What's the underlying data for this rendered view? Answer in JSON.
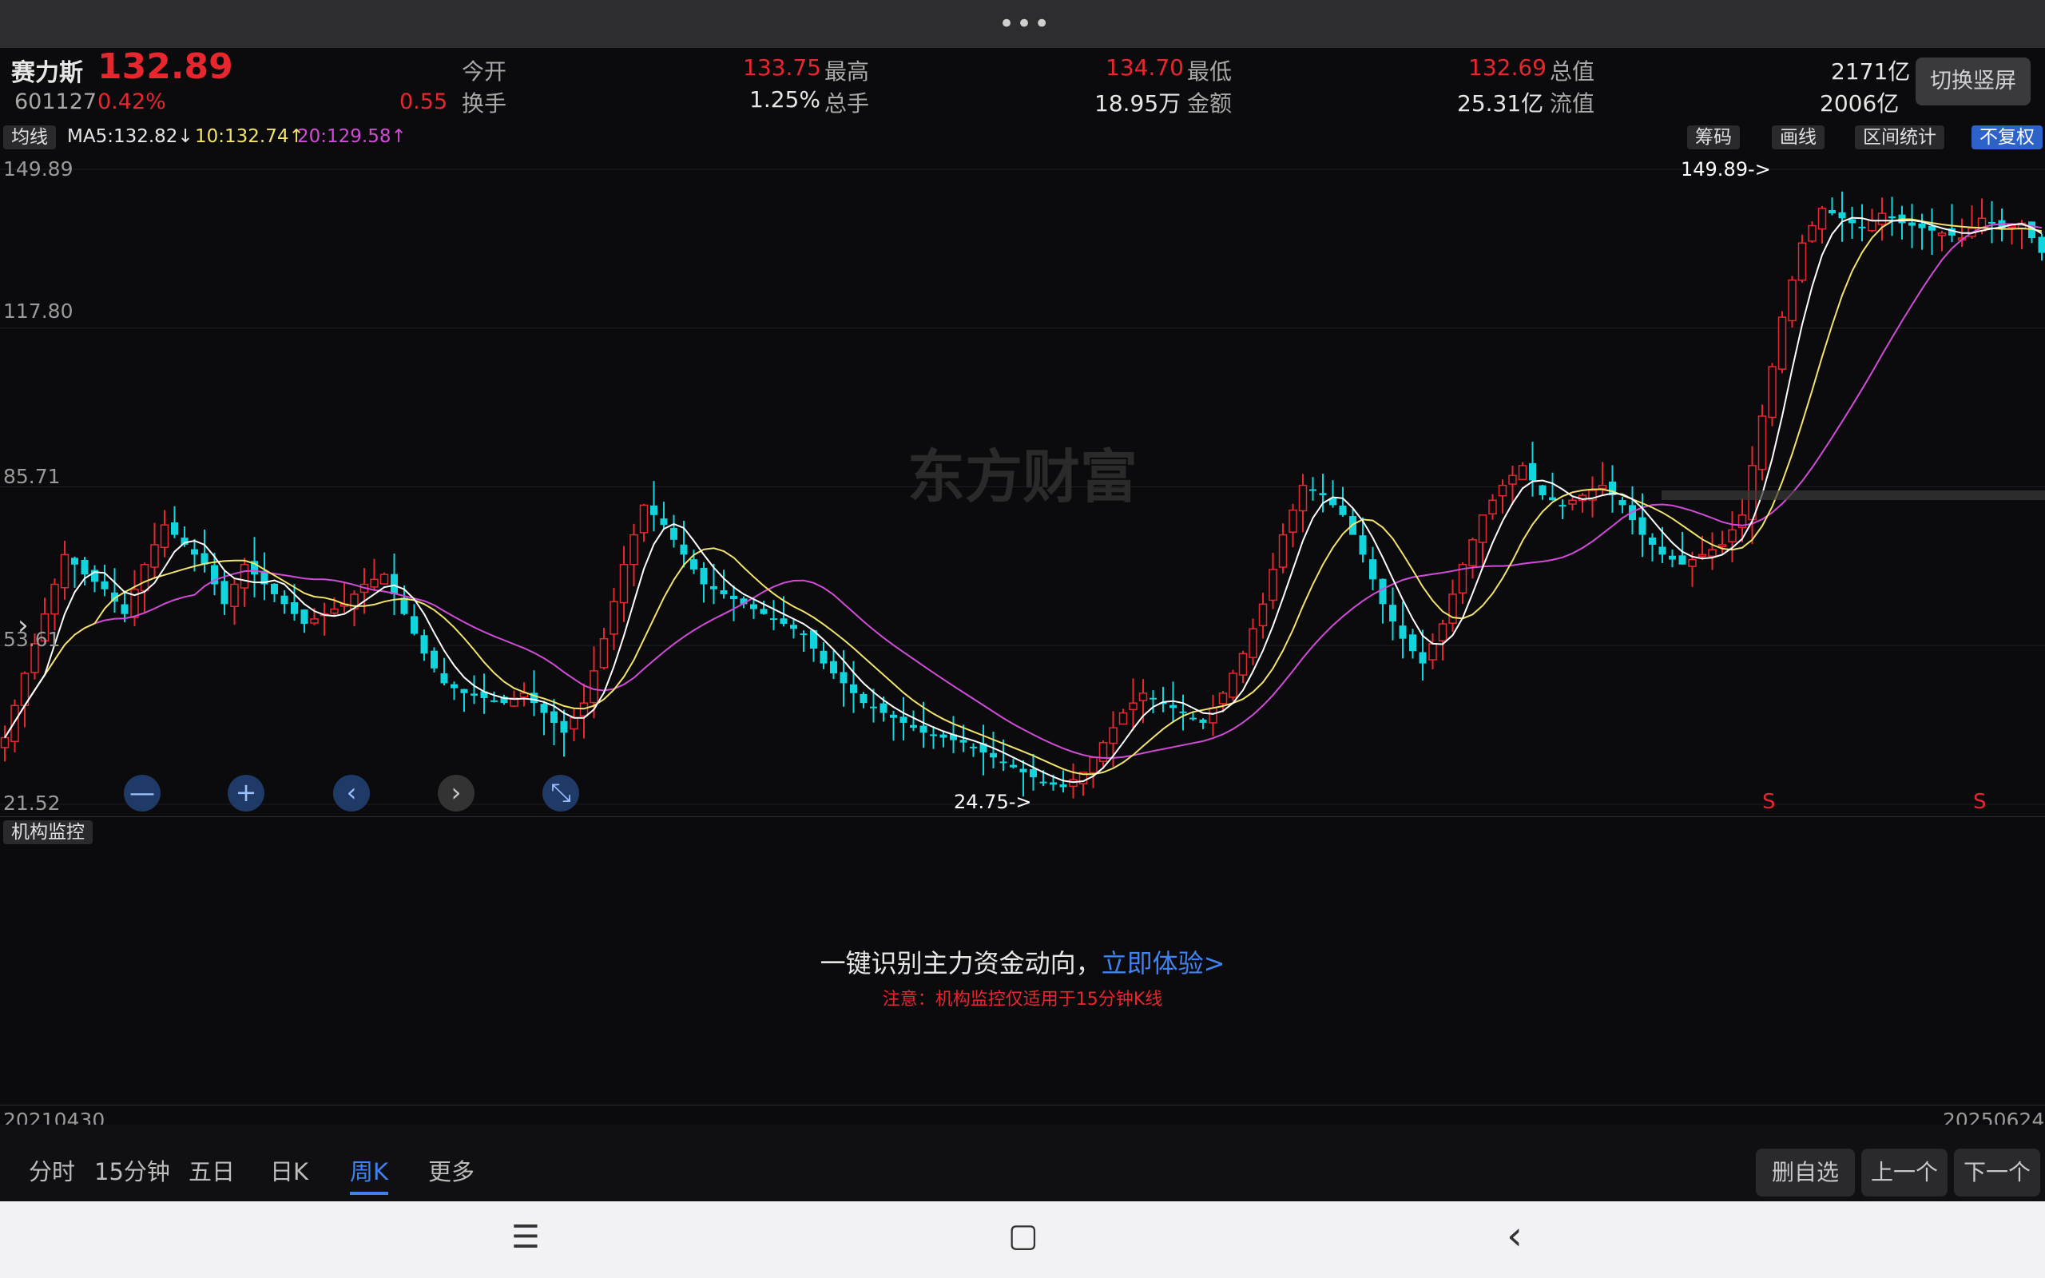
{
  "header": {
    "menu_dots": "•••"
  },
  "quote": {
    "name": "赛力斯",
    "price": "132.89",
    "code": "601127",
    "pct": "0.42%",
    "change": "0.55",
    "open_label": "今开",
    "open": "133.75",
    "high_label": "最高",
    "high": "134.70",
    "low_label": "最低",
    "low": "132.69",
    "mcap_label": "总值",
    "mcap": "2171亿",
    "turnover_label": "换手",
    "turnover": "1.25%",
    "volume_label": "总手",
    "volume": "18.95万",
    "amount_label": "金额",
    "amount": "25.31亿",
    "float_label": "流值",
    "float": "2006亿",
    "switch_label": "切换竖屏"
  },
  "indicators": {
    "selector": "均线",
    "ma5": "MA5:132.82↓",
    "ma10": "10:132.74↑",
    "ma20": "20:129.58↑",
    "chips": [
      "筹码",
      "画线",
      "区间统计",
      "不复权"
    ]
  },
  "chart": {
    "y_labels": [
      "149.89",
      "117.80",
      "85.71",
      "53.61",
      "21.52"
    ],
    "max_marker": "149.89->",
    "min_marker": "24.75->",
    "watermark": "东方财富",
    "s_marks": [
      "S",
      "S"
    ],
    "controls": [
      "—",
      "+",
      "‹",
      "›",
      "⤡"
    ]
  },
  "chart_data": {
    "type": "candlestick",
    "interval": "weekly",
    "ylim": [
      21.52,
      149.89
    ],
    "y_ticks": [
      149.89,
      117.8,
      85.71,
      53.61,
      21.52
    ],
    "max": 149.89,
    "min": 24.75,
    "start_date": "20210430",
    "end_date": "20250624",
    "series": [
      {
        "name": "MA5",
        "value": 132.82,
        "color": "#ffffff"
      },
      {
        "name": "10",
        "value": 132.74,
        "color": "#f2e36a"
      },
      {
        "name": "20",
        "value": 129.58,
        "color": "#d24bd8"
      }
    ],
    "approx_close_path": [
      35,
      48,
      60,
      72,
      68,
      65,
      60,
      70,
      78,
      74,
      70,
      62,
      70,
      66,
      62,
      58,
      60,
      62,
      66,
      68,
      60,
      52,
      46,
      44,
      43,
      42,
      44,
      40,
      36,
      42,
      55,
      70,
      82,
      78,
      72,
      66,
      64,
      62,
      60,
      58,
      56,
      50,
      46,
      42,
      40,
      38,
      36,
      35,
      34,
      32,
      30,
      28,
      26,
      25,
      28,
      34,
      40,
      44,
      42,
      40,
      38,
      44,
      52,
      62,
      76,
      86,
      84,
      80,
      72,
      62,
      55,
      50,
      58,
      70,
      80,
      86,
      90,
      84,
      82,
      84,
      86,
      82,
      76,
      72,
      70,
      72,
      74,
      80,
      100,
      120,
      135,
      142,
      140,
      138,
      141,
      139,
      138,
      137,
      136,
      140,
      138,
      139,
      133
    ]
  },
  "lower": {
    "selector": "机构监控",
    "promo_text": "一键识别主力资金动向，",
    "promo_link": "立即体验>",
    "note": "注意：机构监控仅适用于15分钟K线",
    "date_start": "20210430",
    "date_end": "20250624"
  },
  "tabs": [
    "分时",
    "15分钟",
    "五日",
    "日K",
    "周K",
    "更多"
  ],
  "actions": {
    "del": "删自选",
    "prev": "上一个",
    "next": "下一个"
  },
  "nav": {
    "menu": "☰",
    "home": "▢",
    "back": "‹"
  }
}
